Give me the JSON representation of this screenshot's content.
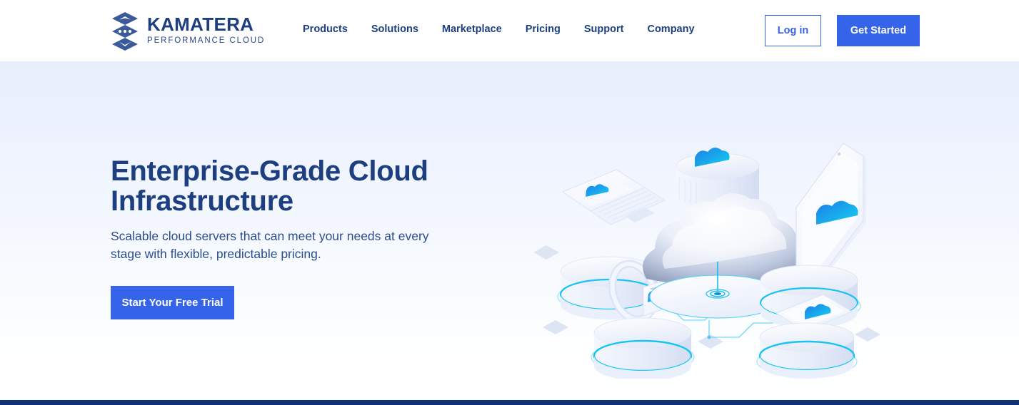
{
  "brand": {
    "logo_icon": "kamatera-stacked-layers-logo",
    "name": "KAMATERA",
    "tagline": "PERFORMANCE CLOUD",
    "navy": "#1d3f80",
    "blue": "#3563e9",
    "cyan": "#13b5ea"
  },
  "nav": {
    "items": [
      {
        "label": "Products"
      },
      {
        "label": "Solutions"
      },
      {
        "label": "Marketplace"
      },
      {
        "label": "Pricing"
      },
      {
        "label": "Support"
      },
      {
        "label": "Company"
      }
    ]
  },
  "header_actions": {
    "login_label": "Log in",
    "get_started_label": "Get Started"
  },
  "hero": {
    "title": "Enterprise-Grade Cloud Infrastructure",
    "subtitle": "Scalable cloud servers that can meet your needs at every stage with flexible, predictable pricing.",
    "cta_label": "Start Your Free Trial",
    "illustration": {
      "name": "isometric-cloud-infrastructure-illustration",
      "elements": [
        "central-cloud-on-disc",
        "server-rack-cylinder",
        "laptop-on-podium",
        "tablet-phone-on-podium",
        "smartwatch-on-podium",
        "tablet-flat-on-podium",
        "circuit-connection-lines",
        "floating-diamonds"
      ]
    }
  }
}
